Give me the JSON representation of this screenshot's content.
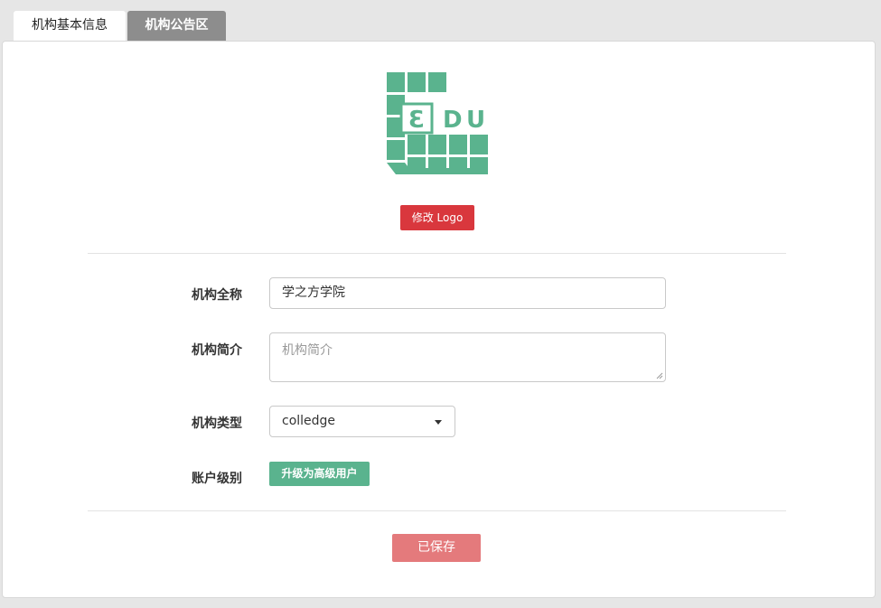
{
  "tabs": [
    {
      "label": "机构基本信息",
      "active": true
    },
    {
      "label": "机构公告区",
      "active": false
    }
  ],
  "logo": {
    "letters": "ƐDU",
    "color": "#5ab38e",
    "button_label": "修改 Logo"
  },
  "form": {
    "name": {
      "label": "机构全称",
      "value": "学之方学院"
    },
    "intro": {
      "label": "机构简介",
      "placeholder": "机构简介"
    },
    "type": {
      "label": "机构类型",
      "selected": "colledge"
    },
    "level": {
      "label": "账户级别",
      "button_label": "升级为高级用户"
    }
  },
  "save_button": {
    "label": "已保存",
    "color": "#e47a7c"
  },
  "colors": {
    "accent_red": "#d9373d",
    "accent_green": "#5ab38e",
    "inactive_tab": "#8d8d8d"
  }
}
